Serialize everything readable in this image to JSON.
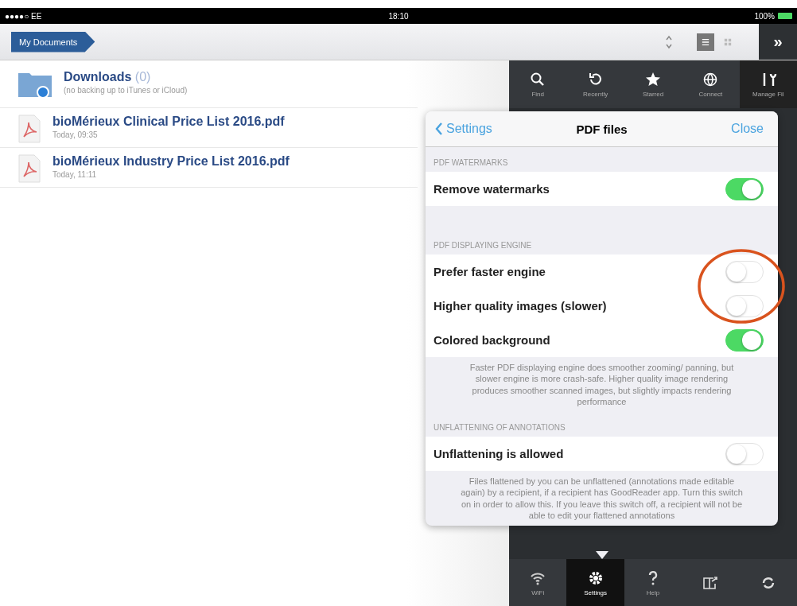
{
  "status_bar": {
    "carrier": "●●●●○ EE",
    "time": "18:10",
    "battery": "100%"
  },
  "nav_bar": {
    "breadcrumb": "My Documents",
    "view_modes": [
      {
        "kind": "list",
        "selected": true
      },
      {
        "kind": "grid",
        "selected": false
      }
    ],
    "more": "»"
  },
  "files": [
    {
      "kind": "folder",
      "name": "Downloads",
      "count": "(0)",
      "detail": "(no backing up to iTunes or iCloud)"
    },
    {
      "kind": "pdf",
      "name": "bioMérieux Clinical Price List 2016.pdf",
      "detail": "Today, 09:35"
    },
    {
      "kind": "pdf",
      "name": "bioMérieux Industry Price List 2016.pdf",
      "detail": "Today, 11:11"
    }
  ],
  "top_toolbar": [
    {
      "kind": "search",
      "label": "Find"
    },
    {
      "kind": "recent",
      "label": "Recently"
    },
    {
      "kind": "star",
      "label": "Starred"
    },
    {
      "kind": "globe",
      "label": "Connect"
    },
    {
      "kind": "tools",
      "label": "Manage Fil"
    }
  ],
  "popover": {
    "back": "Settings",
    "title": "PDF files",
    "close": "Close",
    "sections": [
      {
        "header": "PDF WATERMARKS",
        "rows": [
          {
            "label": "Remove watermarks",
            "on": true
          }
        ]
      },
      {
        "header": "PDF DISPLAYING ENGINE",
        "rows": [
          {
            "label": "Prefer faster engine",
            "on": false
          },
          {
            "label": "Higher quality images (slower)",
            "on": false
          },
          {
            "label": "Colored background",
            "on": true
          }
        ],
        "footer": "Faster PDF displaying engine does smoother zooming/ panning, but slower engine is more crash-safe. Higher quality image rendering produces smoother scanned images, but slightly impacts rendering performance"
      },
      {
        "header": "UNFLATTENING OF ANNOTATIONS",
        "rows": [
          {
            "label": "Unflattening is allowed",
            "on": false
          }
        ],
        "footer": "Files flattened by you can be unflattened (annotations made editable again) by a recipient, if a recipient has GoodReader app. Turn this switch on in order to allow this. If you leave this switch off, a recipient will not be able to edit your flattened annotations"
      }
    ]
  },
  "bottom_toolbar": [
    {
      "kind": "wifi",
      "label": "WiFi",
      "selected": false
    },
    {
      "kind": "gear",
      "label": "Settings",
      "selected": true
    },
    {
      "kind": "help",
      "label": "Help",
      "selected": false
    },
    {
      "kind": "book",
      "selected": false
    },
    {
      "kind": "sync",
      "selected": false
    }
  ]
}
